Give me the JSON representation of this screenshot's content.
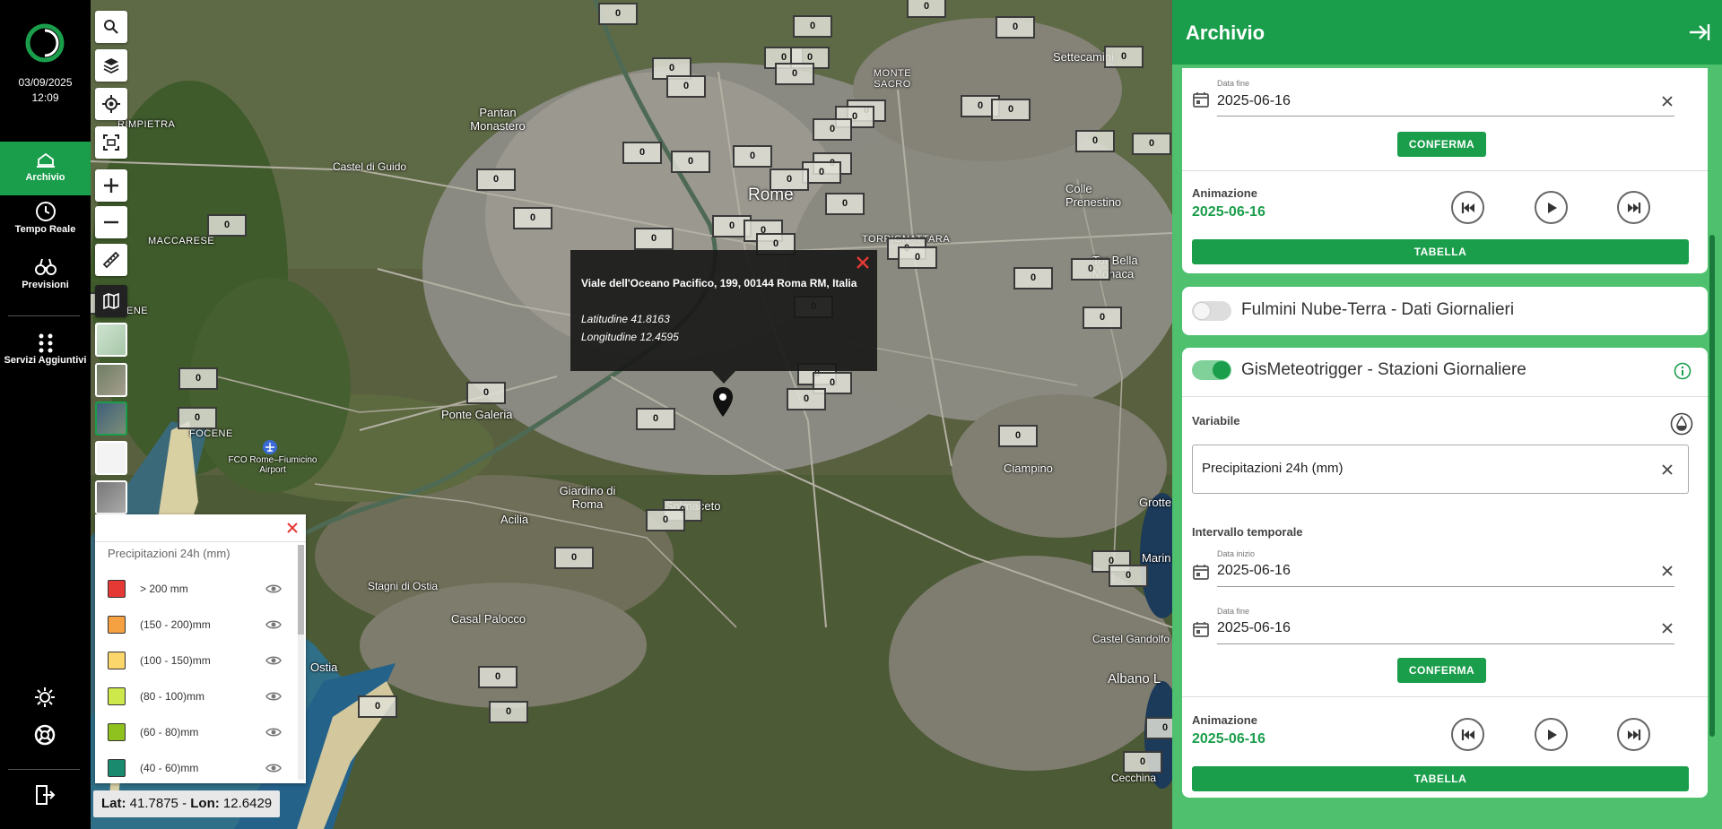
{
  "nav": {
    "date": "03/09/2025",
    "time": "12:09",
    "items": [
      {
        "label": "Archivio",
        "icon": "archive-icon"
      },
      {
        "label": "Tempo Reale",
        "icon": "clock-icon"
      },
      {
        "label": "Previsioni",
        "icon": "binoculars-icon"
      },
      {
        "label": "Servizi Aggiuntivi",
        "icon": "apps-icon"
      }
    ]
  },
  "map": {
    "places": [
      "Rome",
      "Settecamini",
      "MONTE SACRO",
      "Pantan Monastero",
      "Castel di Guido",
      "RIMPIETRA",
      "MACCARESE",
      "TORPIGNATTARA",
      "Tor Bella Monaca",
      "Colle Prenestino",
      "Ponte Galeria",
      "FOCENE",
      "FCO Rome–Fiumicino Airport",
      "Giardino di Roma",
      "Acilia",
      "Solmaceto",
      "Ciampino",
      "Stagni di Ostia",
      "Casal Palocco",
      "Ostia",
      "Grotte",
      "Marin",
      "Castel Gandolfo",
      "Albano L",
      "Cecchina",
      "ENE"
    ],
    "marker_value": "0",
    "popup": {
      "address": "Viale dell'Oceano Pacifico, 199, 00144 Roma RM, Italia",
      "lat": "Latitudine 41.8163",
      "lon": "Longitudine 12.4595"
    },
    "coords_lat_label": "Lat:",
    "coords_lat": "41.7875",
    "coords_lon_label": "Lon:",
    "coords_lon": "12.6429"
  },
  "legend": {
    "title": "Precipitazioni 24h (mm)",
    "items": [
      {
        "label": "> 200 mm",
        "color": "#e53935"
      },
      {
        "label": "(150 - 200)mm",
        "color": "#f5a142"
      },
      {
        "label": "(100 - 150)mm",
        "color": "#fbd66b"
      },
      {
        "label": "(80 - 100)mm",
        "color": "#cde84a"
      },
      {
        "label": "(60 - 80)mm",
        "color": "#8fc21f"
      },
      {
        "label": "(40 - 60)mm",
        "color": "#1a8a6e"
      }
    ]
  },
  "panel": {
    "title": "Archivio",
    "card1": {
      "end_label": "Data fine",
      "end_value": "2025-06-16",
      "confirm": "CONFERMA",
      "anim_label": "Animazione",
      "anim_date": "2025-06-16",
      "table": "TABELLA"
    },
    "card2": {
      "title": "Fulmini Nube-Terra - Dati Giornalieri"
    },
    "card3": {
      "title": "GisMeteotrigger - Stazioni Giornaliere",
      "variable_label": "Variabile",
      "variable_value": "Precipitazioni 24h (mm)",
      "interval_label": "Intervallo temporale",
      "start_label": "Data inizio",
      "start_value": "2025-06-16",
      "end_label": "Data fine",
      "end_value": "2025-06-16",
      "confirm": "CONFERMA",
      "anim_label": "Animazione",
      "anim_date": "2025-06-16",
      "table": "TABELLA"
    }
  },
  "colors": {
    "brand_green": "#1a9e4b",
    "panel_bg": "#4fc16e",
    "nav_bg": "#000000"
  }
}
